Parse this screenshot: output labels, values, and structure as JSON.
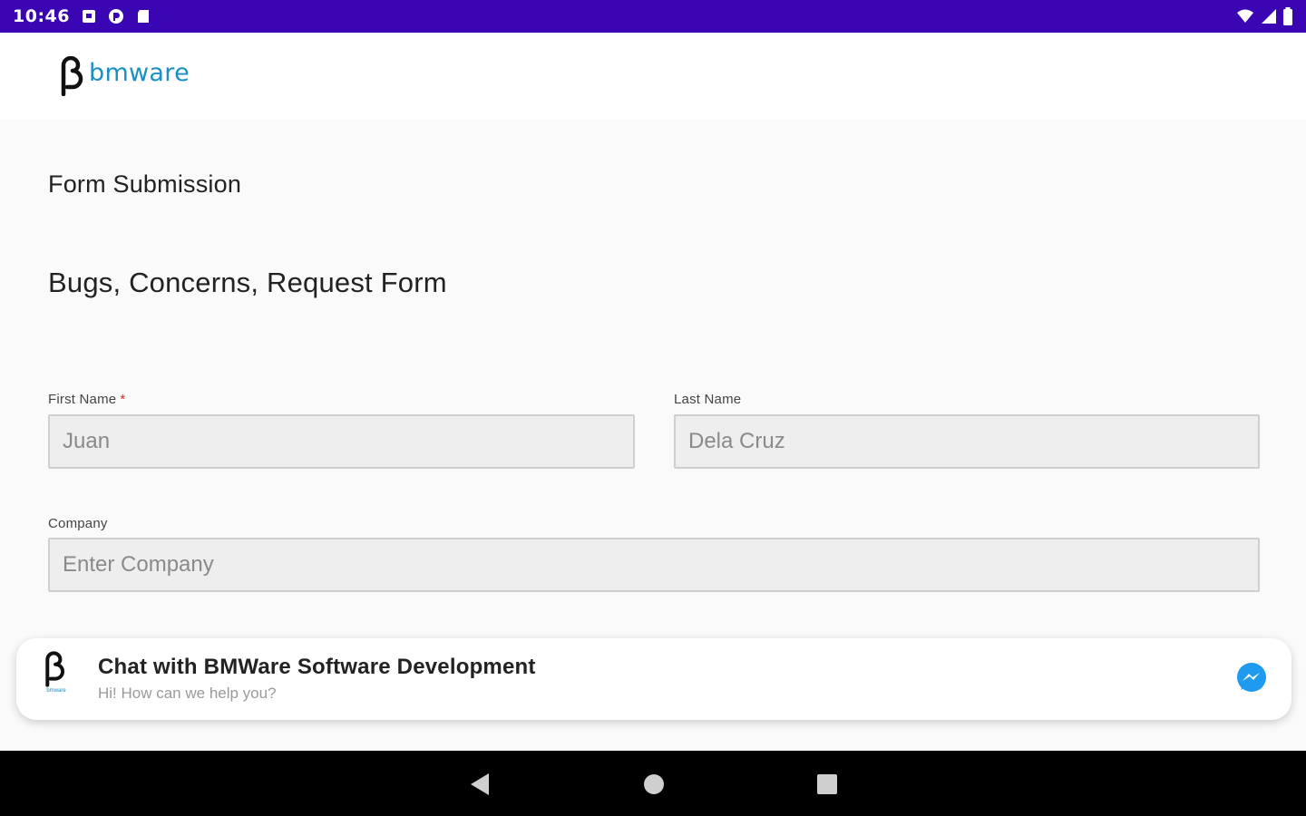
{
  "status_bar": {
    "time": "10:46",
    "left_icons": [
      "notification-square-icon",
      "pocket-icon",
      "sd-card-icon"
    ],
    "right_icons": [
      "wifi-icon",
      "cellular-signal-icon",
      "battery-icon"
    ],
    "background": "#3a06b4"
  },
  "header": {
    "logo_text": "bmware",
    "logo_color": "#1b8fc4"
  },
  "page": {
    "subtitle": "Form Submission",
    "title": "Bugs, Concerns, Request Form"
  },
  "form": {
    "first_name": {
      "label": "First Name",
      "required_mark": "*",
      "value": "Juan",
      "placeholder": "Juan"
    },
    "last_name": {
      "label": "Last Name",
      "value": "Dela Cruz",
      "placeholder": "Dela Cruz"
    },
    "company": {
      "label": "Company",
      "value": "",
      "placeholder": "Enter Company"
    }
  },
  "chat": {
    "title": "Chat with BMWare Software Development",
    "subtitle": "Hi! How can we help you?",
    "logo_caption": "bmware",
    "icon": "messenger-icon"
  },
  "nav_bar": {
    "buttons": [
      "back-icon",
      "home-icon",
      "recents-icon"
    ]
  }
}
